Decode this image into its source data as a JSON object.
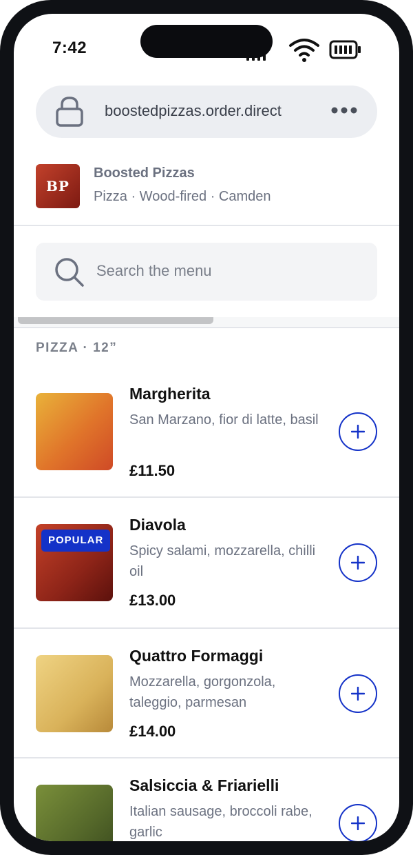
{
  "status": {
    "time": "7:42"
  },
  "browser": {
    "url": "boostedpizzas.order.direct"
  },
  "store": {
    "logo_text": "BP",
    "name": "Boosted Pizzas",
    "tags": "Pizza · Wood-fired · Camden"
  },
  "search": {
    "placeholder": "Search the menu"
  },
  "section": {
    "title": "PIZZA · 12”"
  },
  "items": [
    {
      "name": "Margherita",
      "desc": "San Marzano, fior di latte, basil",
      "price": "£11.50",
      "badge": ""
    },
    {
      "name": "Diavola",
      "desc": "Spicy salami, mozzarella, chilli oil",
      "price": "£13.00",
      "badge": "POPULAR"
    },
    {
      "name": "Quattro Formaggi",
      "desc": "Mozzarella, gorgonzola, taleggio, parmesan",
      "price": "£14.00",
      "badge": ""
    },
    {
      "name": "Salsiccia & Friarielli",
      "desc": "Italian sausage, broccoli rabe, garlic",
      "price": "",
      "badge": ""
    }
  ],
  "colors": {
    "accent": "#1432c8",
    "muted_text": "#6b7180"
  },
  "icons": [
    "lock-icon",
    "more-icon",
    "search-icon",
    "plus-icon",
    "signal-icon",
    "wifi-icon",
    "battery-icon"
  ]
}
